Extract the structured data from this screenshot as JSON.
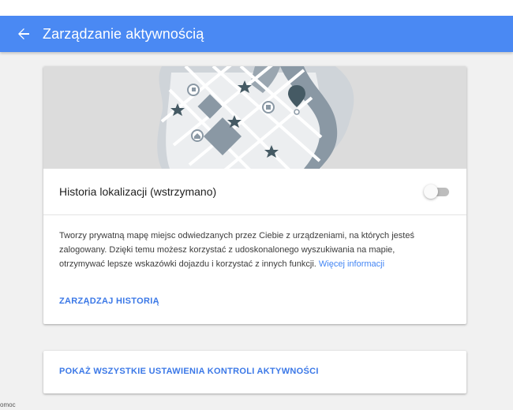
{
  "header": {
    "title": "Zarządzanie aktywnością",
    "back_icon": "arrow-back-icon"
  },
  "colors": {
    "appbar": "#4a89f3",
    "link": "#3b78e7",
    "background": "#f1f1f1"
  },
  "location_history": {
    "label": "Historia lokalizacji (wstrzymano)",
    "enabled": false,
    "description": "Tworzy prywatną mapę miejsc odwiedzanych przez Ciebie z urządzeniami, na których jesteś zalogowany. Dzięki temu możesz korzystać z udoskonalonego wyszukiwania na mapie, otrzymywać lepsze wskazówki dojazdu i korzystać z innych funkcji.",
    "more_info_link": "Więcej informacji",
    "manage_link": "ZARZĄDZAJ HISTORIĄ"
  },
  "activity_controls": {
    "show_all_link": "POKAŻ WSZYSTKIE USTAWIENIA KONTROLI AKTYWNOŚCI"
  },
  "footer": {
    "help_text": "omoc"
  }
}
